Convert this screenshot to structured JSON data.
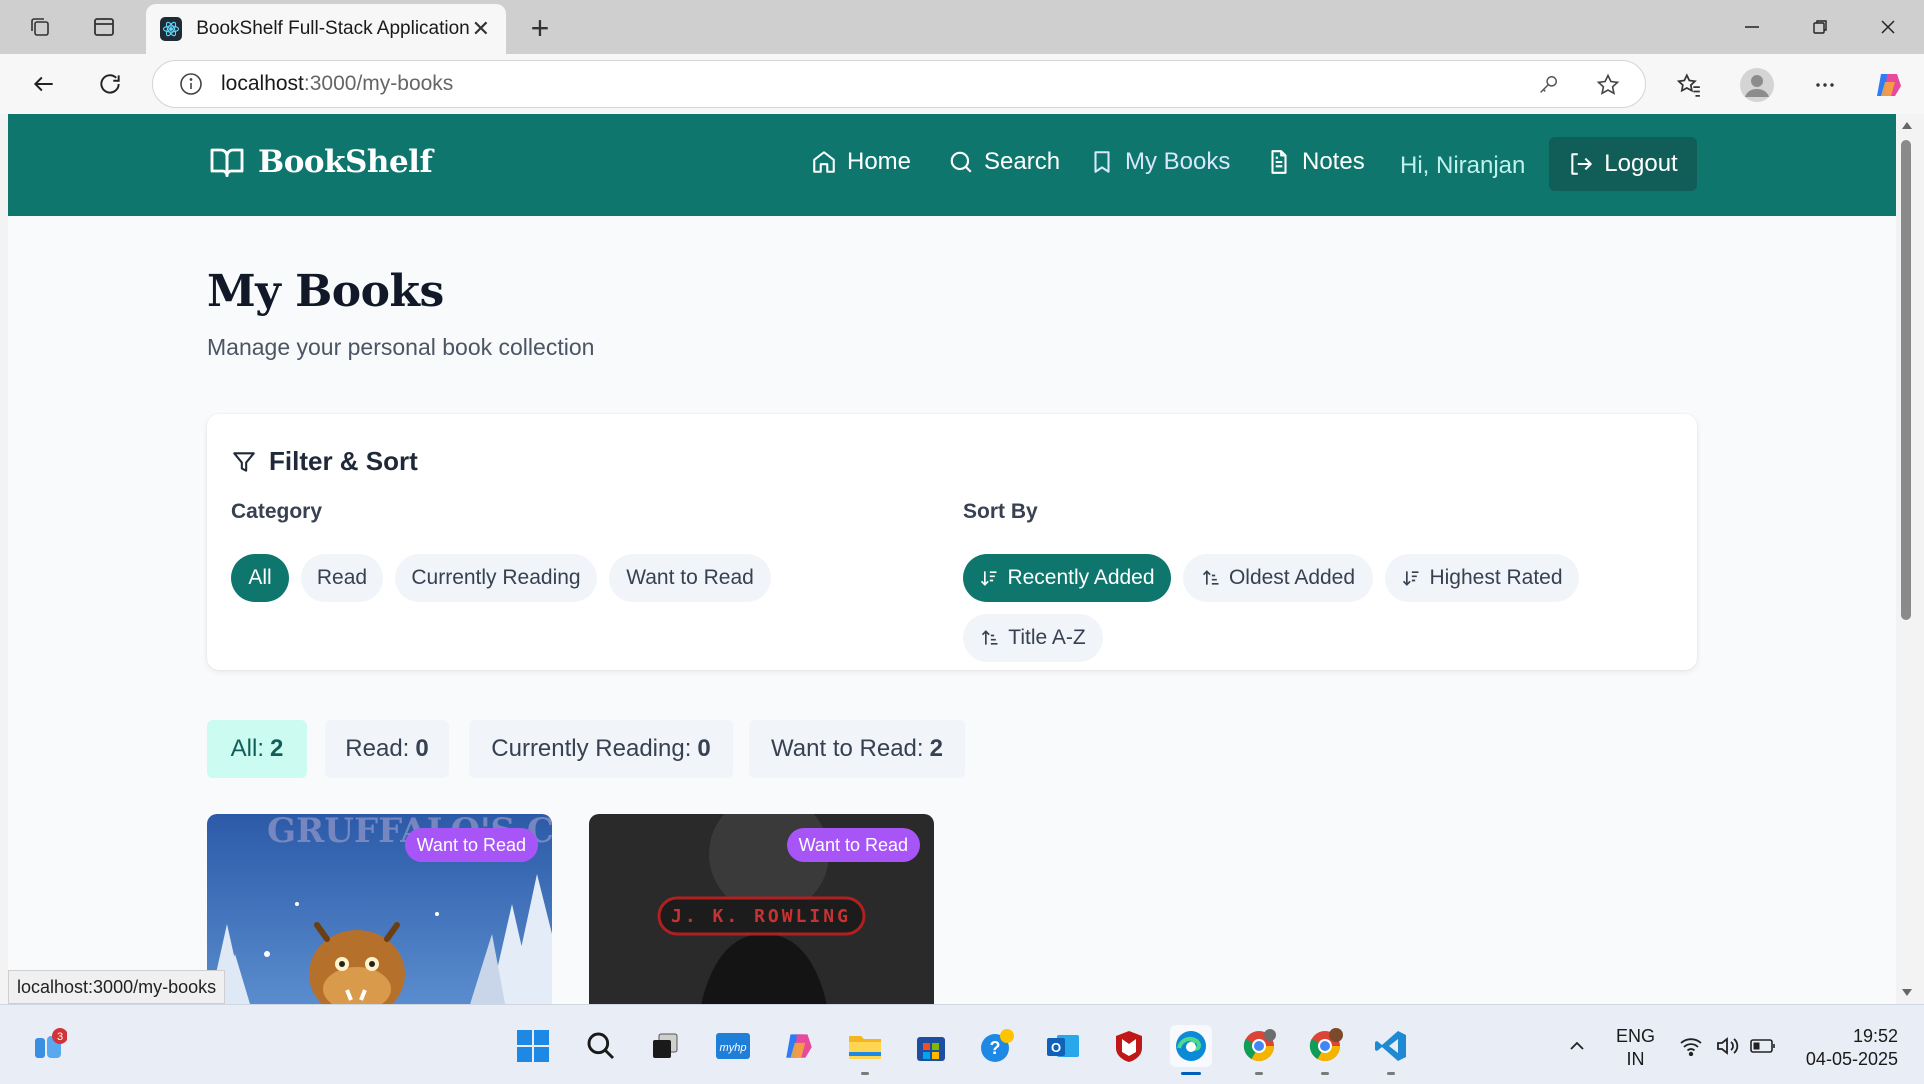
{
  "browser": {
    "tab_title": "BookShelf Full-Stack Application",
    "url_host": "localhost",
    "url_path": ":3000/my-books",
    "status_link": "localhost:3000/my-books"
  },
  "app": {
    "brand": "BookShelf",
    "nav": {
      "home": "Home",
      "search": "Search",
      "my_books": "My Books",
      "notes": "Notes",
      "greeting": "Hi, Niranjan",
      "logout": "Logout"
    }
  },
  "page": {
    "title": "My Books",
    "subtitle": "Manage your personal book collection"
  },
  "filter": {
    "title": "Filter & Sort",
    "category_label": "Category",
    "categories": [
      "All",
      "Read",
      "Currently Reading",
      "Want to Read"
    ],
    "active_category": "All",
    "sort_label": "Sort By",
    "sorts": [
      "Recently Added",
      "Oldest Added",
      "Highest Rated",
      "Title A-Z"
    ],
    "active_sort": "Recently Added"
  },
  "stats": [
    {
      "label": "All:",
      "count": "2"
    },
    {
      "label": "Read:",
      "count": "0"
    },
    {
      "label": "Currently Reading:",
      "count": "0"
    },
    {
      "label": "Want to Read:",
      "count": "2"
    }
  ],
  "books": [
    {
      "status": "Want to Read",
      "cover_text": "GRUFFALO'S CHILD"
    },
    {
      "status": "Want to Read",
      "cover_text": "J. K. ROWLING"
    }
  ],
  "taskbar": {
    "notification_count": "3",
    "lang_line1": "ENG",
    "lang_line2": "IN",
    "time": "19:52",
    "date": "04-05-2025"
  },
  "colors": {
    "brand_teal": "#0f766e",
    "dark_teal": "#115e59",
    "badge_purple": "#a855f7",
    "stat_active_bg": "#ccfbf1"
  }
}
